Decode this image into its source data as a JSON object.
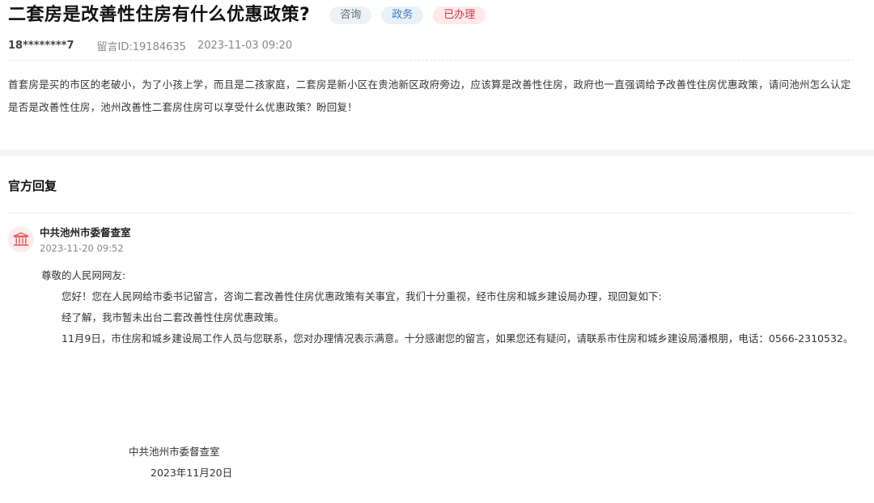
{
  "question": {
    "title": "二套房是改善性住房有什么优惠政策?",
    "tags": [
      "咨询",
      "政务",
      "已办理"
    ],
    "user": "18********7",
    "message_id": "留言ID:19184635",
    "datetime": "2023-11-03 09:20",
    "body": "首套房是买的市区的老破小，为了小孩上学，而且是二孩家庭，二套房是新小区在贵池新区政府旁边，应该算是改善性住房，政府也一直强调给予改善性住房优惠政策，请问池州怎么认定是否是改善性住房，池州改善性二套房住房可以享受什么优惠政策？盼回复！"
  },
  "reply": {
    "section_title": "官方回复",
    "org_icon": "government-building-icon",
    "org_name": "中共池州市委督查室",
    "org_datetime": "2023-11-20 09:52",
    "greeting": "尊敬的人民网网友:",
    "paragraphs": [
      "您好！您在人民网给市委书记留言，咨询二套改善性住房优惠政策有关事宜，我们十分重视，经市住房和城乡建设局办理，现回复如下:",
      "经了解，我市暂未出台二套改善性住房优惠政策。",
      "11月9日，市住房和城乡建设局工作人员与您联系，您对办理情况表示满意。十分感谢您的留言，如果您还有疑问，请联系市住房和城乡建设局潘根朋，电话：0566-2310532。"
    ],
    "signature_org": "中共池州市委督查室",
    "signature_date": "2023年11月20日"
  },
  "colors": {
    "tag_consult_bg": "#eef1f5",
    "tag_gov_bg": "#e8f1fa",
    "tag_done_bg": "#fde9ea",
    "tag_done_text": "#d23b3f",
    "icon_red": "#e35b5b"
  }
}
